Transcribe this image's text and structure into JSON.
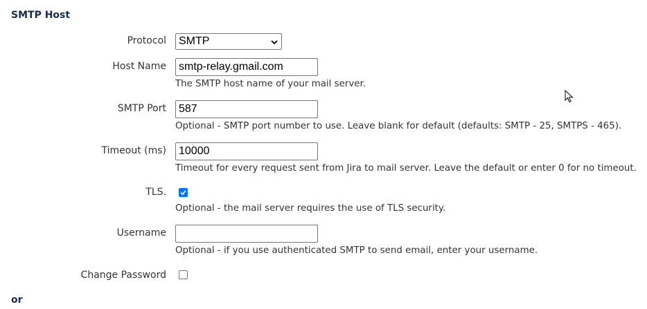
{
  "section": {
    "title": "SMTP Host",
    "or_label": "or"
  },
  "fields": {
    "protocol": {
      "label": "Protocol",
      "selected": "SMTP",
      "icon": "chevron-down-icon"
    },
    "host_name": {
      "label": "Host Name",
      "value": "smtp-relay.gmail.com",
      "description": "The SMTP host name of your mail server."
    },
    "smtp_port": {
      "label": "SMTP Port",
      "value": "587",
      "description": "Optional - SMTP port number to use. Leave blank for default (defaults: SMTP - 25, SMTPS - 465)."
    },
    "timeout": {
      "label": "Timeout (ms)",
      "value": "10000",
      "description": "Timeout for every request sent from Jira to mail server. Leave the default or enter 0 for no timeout."
    },
    "tls": {
      "label": "TLS.",
      "checked": true,
      "description": "Optional - the mail server requires the use of TLS security."
    },
    "username": {
      "label": "Username",
      "value": "",
      "description": "Optional - if you use authenticated SMTP to send email, enter your username."
    },
    "change_password": {
      "label": "Change Password",
      "checked": false
    }
  },
  "colors": {
    "checkbox_checked": "#0075ff",
    "heading": "#172b4d",
    "text": "#333333"
  },
  "icons": {
    "cursor": "mouse-pointer-icon",
    "check": "checkmark-icon"
  }
}
